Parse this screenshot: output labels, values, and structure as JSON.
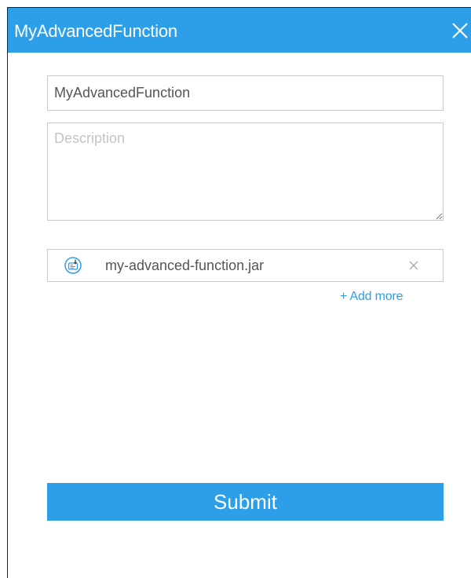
{
  "dialog": {
    "title": "MyAdvancedFunction",
    "header_color": "#2d9fe9",
    "close_icon": "close-icon"
  },
  "form": {
    "name_value": "MyAdvancedFunction",
    "description_placeholder": "Description",
    "file": {
      "icon": "jar-file-icon",
      "name": "my-advanced-function.jar",
      "remove_icon": "remove-icon"
    },
    "add_more_label": "+ Add more",
    "submit_label": "Submit"
  }
}
